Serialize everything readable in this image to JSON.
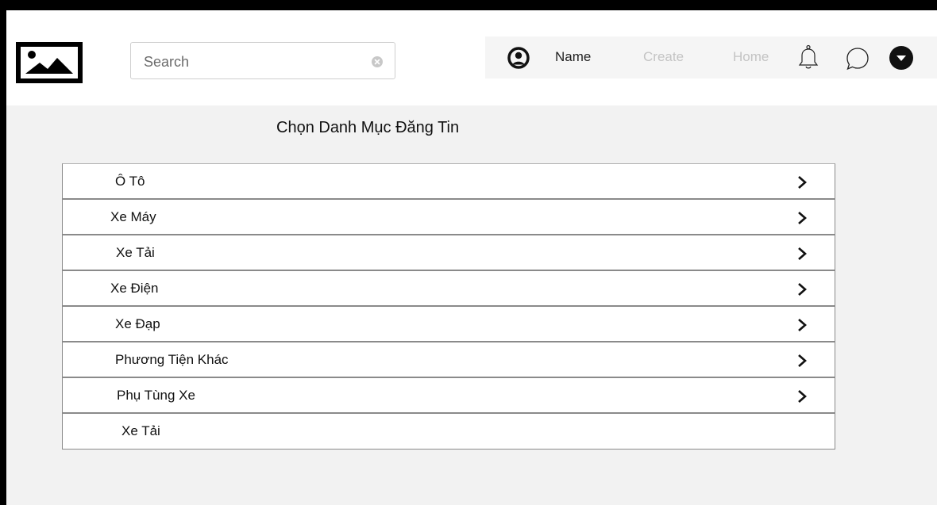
{
  "header": {
    "search": {
      "placeholder": "Search",
      "value": ""
    },
    "nav": {
      "name": "Name",
      "create": "Create",
      "home": "Home"
    }
  },
  "page": {
    "title": "Chọn Danh Mục Đăng Tin"
  },
  "categories": [
    {
      "label": "Ô Tô",
      "chevron": true
    },
    {
      "label": "Xe Máy",
      "chevron": true
    },
    {
      "label": "Xe Tải",
      "chevron": true
    },
    {
      "label": "Xe Điện",
      "chevron": true
    },
    {
      "label": "Xe Đạp",
      "chevron": true
    },
    {
      "label": "Phương Tiện Khác",
      "chevron": true
    },
    {
      "label": "Phụ Tùng Xe",
      "chevron": true
    },
    {
      "label": "Xe Tải",
      "chevron": false
    }
  ],
  "icons": {
    "logo": "image-placeholder-icon",
    "clear": "clear-circle-icon",
    "avatar": "user-circle-icon",
    "bell": "bell-icon",
    "chat": "chat-bubble-icon",
    "menu": "dropdown-circle-icon",
    "chevron": "chevron-right-icon"
  },
  "colors": {
    "accent": "#000000",
    "inactive_nav": "#c4c4c4",
    "nav_bg": "#f5f5f5",
    "page_bg": "#f2f2f2"
  }
}
